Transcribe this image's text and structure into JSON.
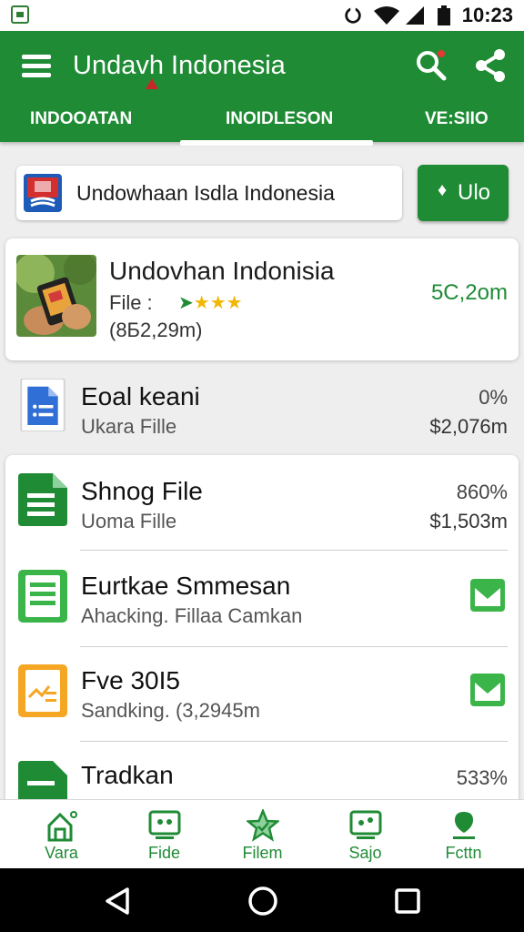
{
  "status_bar": {
    "time": "10:23"
  },
  "app_bar": {
    "title": "Undavh Indonesia",
    "tabs": [
      {
        "label": "INDOOATAN"
      },
      {
        "label": "INOIDLESON"
      },
      {
        "label": "VE:SIIO"
      }
    ]
  },
  "search": {
    "text": "Undowhaan Isdla Indonesia",
    "button_label": "Ulo"
  },
  "featured": {
    "name": "Undovhan Indonisia",
    "meta_label": "File :",
    "size": "(8Б2,29m)",
    "amount": "5C,2om"
  },
  "rows": [
    {
      "title": "Eoal keani",
      "subtitle": "Ukara Fille",
      "right_top": "0%",
      "right_bottom": "$2,076m"
    },
    {
      "title": "Shnog File",
      "subtitle": "Uoma Fille",
      "right_top": "860%",
      "right_bottom": "$1,503m"
    },
    {
      "title": "Eurtkae Smmesan",
      "subtitle": "Ahacking. Fillaa Camkan"
    },
    {
      "title": "Fve 30I5",
      "subtitle": "Sandking. (3,2945m"
    },
    {
      "title": "Tradkan",
      "right_top": "533%"
    }
  ],
  "bottom_nav": [
    {
      "label": "Vara"
    },
    {
      "label": "Fide"
    },
    {
      "label": "Filem"
    },
    {
      "label": "Sajo"
    },
    {
      "label": "Fcttn"
    }
  ],
  "colors": {
    "primary": "#1f8b35",
    "accent_orange": "#f5a623",
    "doc_blue": "#2f6fd6",
    "light_green": "#3bb54a"
  },
  "icons": [
    "menu-icon",
    "search-icon",
    "share-icon",
    "upload-icon",
    "doc-icon",
    "spreadsheet-icon",
    "mail-icon",
    "home-icon",
    "star-icon",
    "back-icon",
    "home-circle-icon",
    "recents-icon"
  ]
}
